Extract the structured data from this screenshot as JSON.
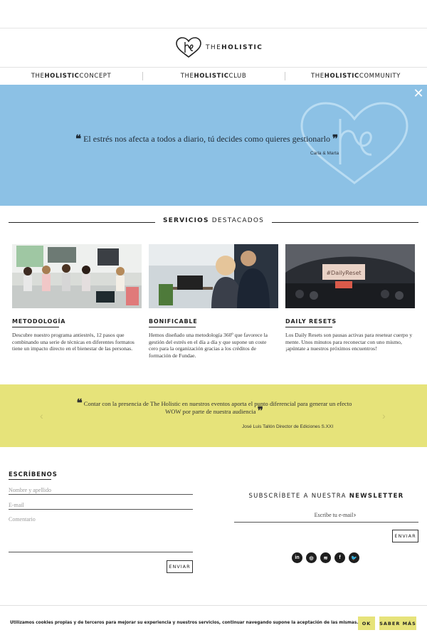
{
  "brand": {
    "prefix": "THE",
    "bold": "HOLISTIC"
  },
  "nav": [
    {
      "prefix": "THE",
      "bold": "HOLISTIC",
      "suffix": "CONCEPT"
    },
    {
      "prefix": "THE",
      "bold": "HOLISTIC",
      "suffix": "CLUB"
    },
    {
      "prefix": "THE",
      "bold": "HOLISTIC",
      "suffix": "COMMUNITY"
    }
  ],
  "hero": {
    "quote": "El estrés nos afecta a todos a diario, tú decides como quieres gestionarlo",
    "author": "Carla & Marta",
    "close_icon": "close-icon",
    "color": "#8cc1e5"
  },
  "services": {
    "title_bold": "SERVICIOS",
    "title_rest": "DESTACADOS",
    "items": [
      {
        "title": "METODOLOGÍA",
        "text": "Descubre nuestro programa antiestrés, 12 pasos que combinando una serie de técnicas en diferentes formatos tiene un impacto directo en el bienestar de las personas."
      },
      {
        "title": "BONIFICABLE",
        "text": "Hemos diseñado una metodología 360º que favorece la gestión del estrés en el día a día y que supone un coste cero para la organización gracias a los créditos de formación de Fundae."
      },
      {
        "title": "DAILY RESETS",
        "text": "Los Daily Resets son pausas activas para resetear cuerpo y mente. Unos minutos para reconectar con uno mismo, ¡apúntate a nuestros próximos encuentros!",
        "screen_text": "#DailyReset"
      }
    ]
  },
  "testimonial": {
    "quote": "Contar con la presencia de The Holistic en nuestros eventos aporta el punto diferencial para generar un efecto WOW por parte de nuestra audiencia",
    "author": "José Luis Tallón Director de Ediciones S.XXI",
    "color": "#e6e37a"
  },
  "contact": {
    "title": "ESCRÍBENOS",
    "name_placeholder": "Nombre y apellido",
    "email_placeholder": "E-mail",
    "comment_placeholder": "Comentario",
    "send_label": "ENVIAR"
  },
  "newsletter": {
    "title_rest": "SUBSCRÍBETE A NUESTRA",
    "title_bold": "NEWSLETTER",
    "placeholder": "Escribe tu e-mail",
    "send_label": "ENVIAR"
  },
  "socials": [
    {
      "name": "linkedin-icon",
      "glyph": "in"
    },
    {
      "name": "instagram-icon",
      "glyph": "◎"
    },
    {
      "name": "spotify-icon",
      "glyph": "≋"
    },
    {
      "name": "facebook-icon",
      "glyph": "f"
    },
    {
      "name": "twitter-icon",
      "glyph": "🐦"
    }
  ],
  "cookie": {
    "text": "Utilizamos cookies propias y de terceros para mejorar su experiencia y nuestros servicios, continuar navegando supone la aceptación de las mismas.",
    "ok_label": "OK",
    "more_label": "SABER MÁS"
  }
}
